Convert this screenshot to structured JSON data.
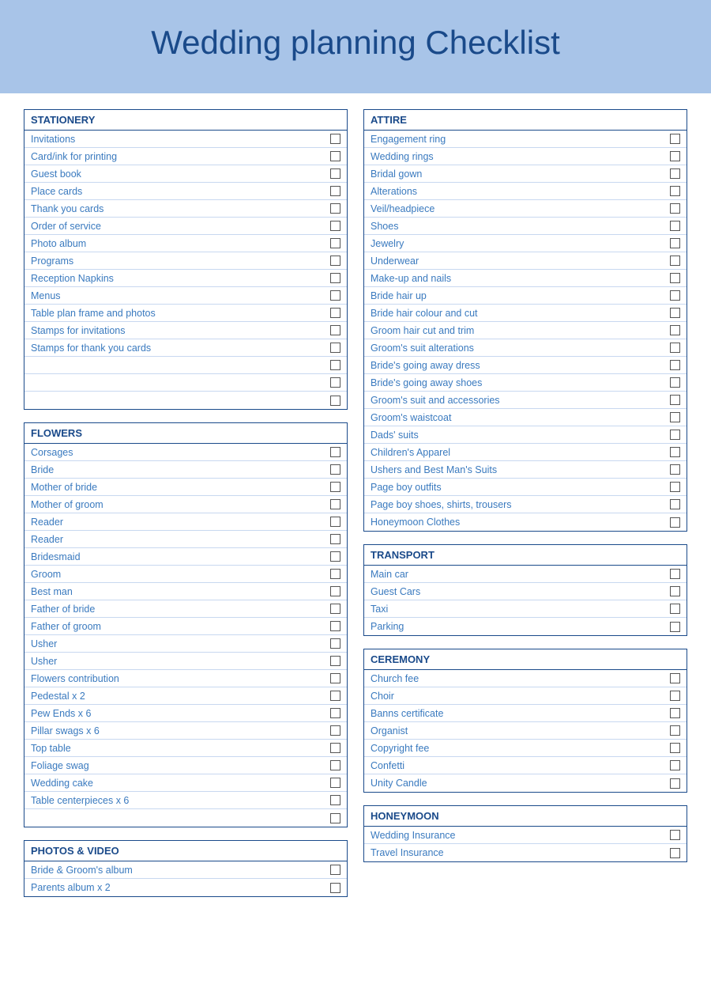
{
  "header": {
    "title": "Wedding planning Checklist"
  },
  "sections": {
    "stationery": {
      "title": "STATIONERY",
      "items": [
        "Invitations",
        "Card/ink for printing",
        "Guest book",
        "Place cards",
        "Thank you cards",
        "Order of service",
        "Photo album",
        "Programs",
        "Reception Napkins",
        "Menus",
        "Table plan frame and photos",
        "Stamps for invitations",
        "Stamps for thank you cards",
        "",
        "",
        ""
      ]
    },
    "flowers": {
      "title": "FLOWERS",
      "items": [
        "Corsages",
        "Bride",
        "Mother of bride",
        "Mother of groom",
        "Reader",
        "Reader",
        "Bridesmaid",
        "Groom",
        "Best man",
        "Father of bride",
        "Father of groom",
        "Usher",
        "Usher",
        "Flowers contribution",
        "Pedestal x 2",
        "Pew Ends x 6",
        "Pillar swags x 6",
        "Top table",
        "Foliage swag",
        "Wedding cake",
        "Table centerpieces x 6",
        ""
      ]
    },
    "attire": {
      "title": "ATTIRE",
      "items": [
        "Engagement ring",
        "Wedding rings",
        "Bridal gown",
        "Alterations",
        "Veil/headpiece",
        "Shoes",
        "Jewelry",
        "Underwear",
        "Make-up and nails",
        "Bride hair up",
        "Bride hair colour and cut",
        "Groom hair cut and trim",
        "Groom's suit alterations",
        "Bride's going away dress",
        "Bride's going away shoes",
        "Groom's suit and accessories",
        "Groom's waistcoat",
        "Dads' suits",
        "Children's Apparel",
        "Ushers and Best Man's Suits",
        "Page boy outfits",
        "Page boy shoes, shirts, trousers",
        "Honeymoon Clothes"
      ]
    },
    "transport": {
      "title": "TRANSPORT",
      "items": [
        "Main car",
        "Guest Cars",
        "Taxi",
        "Parking"
      ]
    },
    "ceremony": {
      "title": "CEREMONY",
      "items": [
        "Church fee",
        "Choir",
        "Banns certificate",
        "Organist",
        "Copyright fee",
        "Confetti",
        "Unity Candle"
      ]
    },
    "photos": {
      "title": "PHOTOS & VIDEO",
      "items": [
        "Bride & Groom's album",
        "Parents album x 2"
      ]
    },
    "honeymoon": {
      "title": "HONEYMOON",
      "items": [
        "Wedding Insurance",
        "Travel Insurance"
      ]
    }
  }
}
